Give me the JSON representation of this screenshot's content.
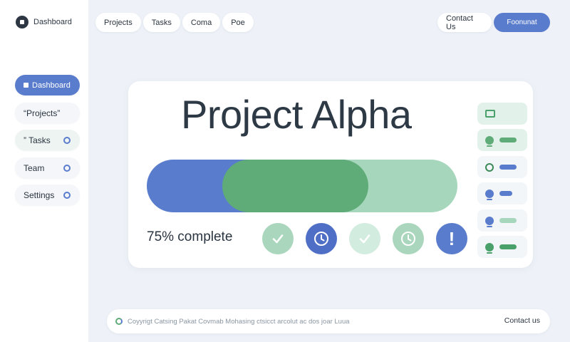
{
  "sidebar": {
    "brand": "Dashboard",
    "items": [
      {
        "label": "Dashboard",
        "state": "active"
      },
      {
        "label": "“Projects”"
      },
      {
        "label": "” Tasks"
      },
      {
        "label": "Team"
      },
      {
        "label": "Settings"
      }
    ]
  },
  "topnav": {
    "tabs": [
      "Projects",
      "Tasks",
      "Coma",
      "Poe"
    ],
    "contact": "Contact Us",
    "cta": "Foonunat"
  },
  "project": {
    "title": "Project Alpha",
    "progress_label": "75% complete",
    "progress": 0.75,
    "statuses": [
      "check",
      "clock",
      "check",
      "clock",
      "alert"
    ],
    "alert_glyph": "!"
  },
  "side_indicators": [
    {
      "icon": "monitor-icon",
      "color": "#4aa06a"
    },
    {
      "icon": "pin-icon",
      "color": "#5fac78"
    },
    {
      "icon": "face-icon",
      "color": "#3c8a58"
    },
    {
      "icon": "user-icon",
      "color": "#5a7ccc"
    },
    {
      "icon": "user-icon",
      "color": "#5a7ccc"
    },
    {
      "icon": "pin-icon",
      "color": "#4aa06a"
    }
  ],
  "footer": {
    "text": "Coyyrigt Catsing Pakat Covmab Mohasing ctsicct arcolut ac dos joar Luua",
    "contact": "Contact us"
  },
  "colors": {
    "accent_blue": "#5a7ccc",
    "accent_green": "#5fac78",
    "light_green": "#a6d7bc",
    "background": "#eef2f8"
  }
}
